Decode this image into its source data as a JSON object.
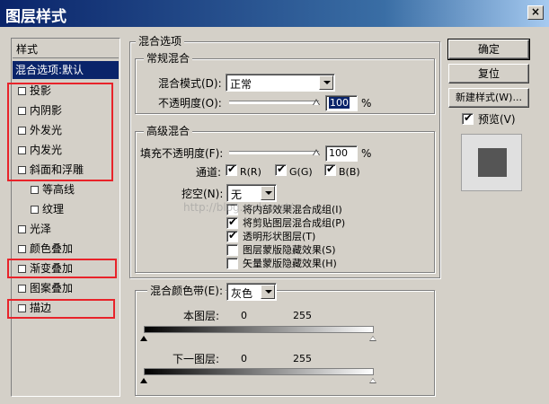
{
  "window": {
    "title": "图层样式",
    "close": "×"
  },
  "left_list": {
    "header": "样式",
    "items": [
      {
        "label": "混合选项:默认",
        "selected": true,
        "checkbox": false
      },
      {
        "label": "投影",
        "checkbox": true
      },
      {
        "label": "内阴影",
        "checkbox": true
      },
      {
        "label": "外发光",
        "checkbox": true
      },
      {
        "label": "内发光",
        "checkbox": true
      },
      {
        "label": "斜面和浮雕",
        "checkbox": true
      },
      {
        "label": "等高线",
        "checkbox": true,
        "sub": true
      },
      {
        "label": "纹理",
        "checkbox": true,
        "sub": true
      },
      {
        "label": "光泽",
        "checkbox": true
      },
      {
        "label": "颜色叠加",
        "checkbox": true
      },
      {
        "label": "渐变叠加",
        "checkbox": true
      },
      {
        "label": "图案叠加",
        "checkbox": true
      },
      {
        "label": "描边",
        "checkbox": true
      }
    ]
  },
  "blend_options": {
    "group_title": "混合选项",
    "general": {
      "title": "常规混合",
      "mode_label": "混合模式(D):",
      "mode_value": "正常",
      "opacity_label": "不透明度(O):",
      "opacity_value": "100",
      "opacity_unit": "%"
    },
    "advanced": {
      "title": "高级混合",
      "fill_label": "填充不透明度(F):",
      "fill_value": "100",
      "fill_unit": "%",
      "channels_label": "通道:",
      "channels": [
        {
          "label": "R(R)",
          "checked": true
        },
        {
          "label": "G(G)",
          "checked": true
        },
        {
          "label": "B(B)",
          "checked": true
        }
      ],
      "knockout_label": "挖空(N):",
      "knockout_value": "无",
      "options": [
        {
          "label": "将内部效果混合成组(I)",
          "checked": false
        },
        {
          "label": "将剪贴图层混合成组(P)",
          "checked": true
        },
        {
          "label": "透明形状图层(T)",
          "checked": true
        },
        {
          "label": "图层蒙版隐藏效果(S)",
          "checked": false
        },
        {
          "label": "矢量蒙版隐藏效果(H)",
          "checked": false
        }
      ]
    },
    "blend_if": {
      "label": "混合颜色带(E):",
      "value": "灰色",
      "this_layer": {
        "label": "本图层:",
        "min": "0",
        "max": "255"
      },
      "underlying": {
        "label": "下一图层:",
        "min": "0",
        "max": "255"
      }
    }
  },
  "buttons": {
    "ok": "确定",
    "reset": "复位",
    "new_style": "新建样式(W)...",
    "preview_label": "预览(V)",
    "preview_checked": true
  },
  "watermark": "http://blog.csdn.net/",
  "colors": {
    "highlight": "#0a246a",
    "annotation": "#e8232a",
    "dialog_bg": "#d4d0c8"
  }
}
